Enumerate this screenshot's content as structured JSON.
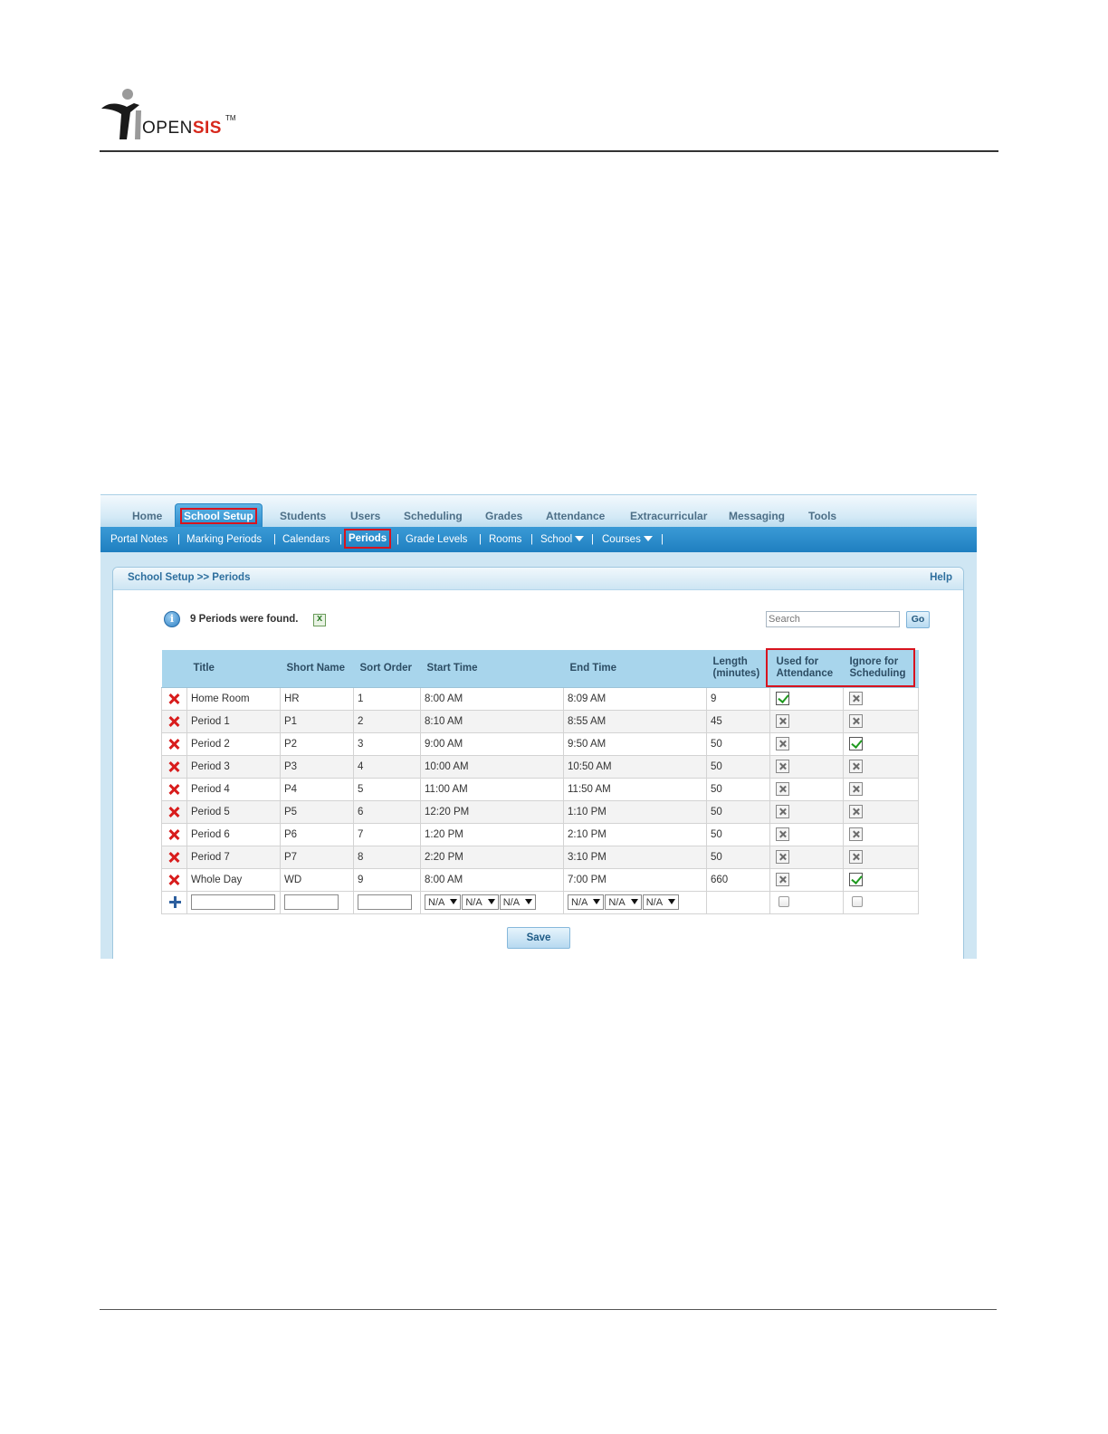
{
  "brand": {
    "open": "OPEN",
    "sis": "SIS",
    "tm": "TM"
  },
  "topnav": {
    "tabs": [
      {
        "label": "Home",
        "active": false
      },
      {
        "label": "School Setup",
        "active": true
      },
      {
        "label": "Students",
        "active": false
      },
      {
        "label": "Users",
        "active": false
      },
      {
        "label": "Scheduling",
        "active": false
      },
      {
        "label": "Grades",
        "active": false
      },
      {
        "label": "Attendance",
        "active": false
      },
      {
        "label": "Extracurricular",
        "active": false
      },
      {
        "label": "Messaging",
        "active": false
      },
      {
        "label": "Tools",
        "active": false
      }
    ]
  },
  "subnav": {
    "items": [
      {
        "label": "Portal Notes"
      },
      {
        "label": "Marking Periods"
      },
      {
        "label": "Calendars"
      },
      {
        "label": "Periods",
        "active": true
      },
      {
        "label": "Grade Levels"
      },
      {
        "label": "Rooms"
      },
      {
        "label": "School",
        "dropdown": true
      },
      {
        "label": "Courses",
        "dropdown": true
      }
    ],
    "separator": "|"
  },
  "panel": {
    "breadcrumb": "School Setup >> Periods",
    "help": "Help",
    "found_text": "9 Periods were found.",
    "search_placeholder": "Search",
    "go_label": "Go",
    "save_label": "Save"
  },
  "table": {
    "headers": {
      "title": "Title",
      "short_name": "Short Name",
      "sort_order": "Sort Order",
      "start_time": "Start Time",
      "end_time": "End Time",
      "length_1": "Length",
      "length_2": "(minutes)",
      "attendance_1": "Used for",
      "attendance_2": "Attendance",
      "scheduling_1": "Ignore for",
      "scheduling_2": "Scheduling"
    },
    "rows": [
      {
        "title": "Home Room",
        "short": "HR",
        "sort": "1",
        "start": "8:00 AM",
        "end": "8:09 AM",
        "length": "9",
        "attendance": true,
        "ignore_sched": false
      },
      {
        "title": "Period 1",
        "short": "P1",
        "sort": "2",
        "start": "8:10 AM",
        "end": "8:55 AM",
        "length": "45",
        "attendance": false,
        "ignore_sched": false
      },
      {
        "title": "Period 2",
        "short": "P2",
        "sort": "3",
        "start": "9:00 AM",
        "end": "9:50 AM",
        "length": "50",
        "attendance": false,
        "ignore_sched": true
      },
      {
        "title": "Period 3",
        "short": "P3",
        "sort": "4",
        "start": "10:00 AM",
        "end": "10:50 AM",
        "length": "50",
        "attendance": false,
        "ignore_sched": false
      },
      {
        "title": "Period 4",
        "short": "P4",
        "sort": "5",
        "start": "11:00 AM",
        "end": "11:50 AM",
        "length": "50",
        "attendance": false,
        "ignore_sched": false
      },
      {
        "title": "Period 5",
        "short": "P5",
        "sort": "6",
        "start": "12:20 PM",
        "end": "1:10 PM",
        "length": "50",
        "attendance": false,
        "ignore_sched": false
      },
      {
        "title": "Period 6",
        "short": "P6",
        "sort": "7",
        "start": "1:20 PM",
        "end": "2:10 PM",
        "length": "50",
        "attendance": false,
        "ignore_sched": false
      },
      {
        "title": "Period 7",
        "short": "P7",
        "sort": "8",
        "start": "2:20 PM",
        "end": "3:10 PM",
        "length": "50",
        "attendance": false,
        "ignore_sched": false
      },
      {
        "title": "Whole Day",
        "short": "WD",
        "sort": "9",
        "start": "8:00 AM",
        "end": "7:00 PM",
        "length": "660",
        "attendance": false,
        "ignore_sched": true
      }
    ],
    "new_row": {
      "start_selects": [
        "N/A",
        "N/A",
        "N/A"
      ],
      "end_selects": [
        "N/A",
        "N/A",
        "N/A"
      ]
    }
  },
  "colors": {
    "highlight": "#d8131e",
    "active_tab": "#2a8ccd",
    "subnav": "#1f7fc0",
    "header_row": "#a8d5ec"
  }
}
